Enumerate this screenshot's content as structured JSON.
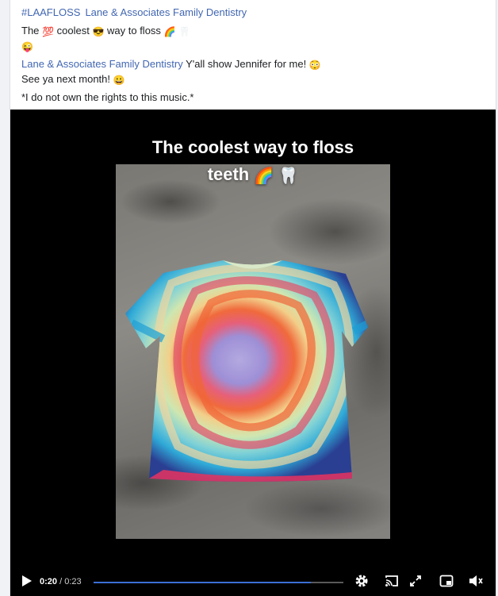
{
  "post": {
    "hashtag": "#LAAFLOSS",
    "page_name": "Lane & Associates Family Dentistry",
    "line1": {
      "pre": "The",
      "mid": "coolest",
      "post": "way to floss"
    },
    "comment": {
      "author": "Lane & Associates Family Dentistry",
      "text": "Y'all show Jennifer for me!",
      "text2": "See ya next month!"
    },
    "disclaimer": "*I do not own the rights to this music.*"
  },
  "emojis": {
    "hundred": "💯",
    "sunglasses": "😎",
    "rainbow": "🌈",
    "tooth": "🦷",
    "wink": "😜",
    "flushed": "😳",
    "grin": "😀"
  },
  "video": {
    "caption_line1": "The coolest way to floss",
    "caption_line2": "teeth",
    "time_current": "0:20",
    "time_sep": " / ",
    "time_total": "0:23",
    "progress": 0.87,
    "accent_color": "#3b70d6"
  },
  "icons": {
    "play": "play-icon",
    "settings": "gear-icon",
    "cast": "cast-icon",
    "fullscreen": "expand-icon",
    "pip": "picture-in-picture-icon",
    "mute": "speaker-muted-icon"
  }
}
